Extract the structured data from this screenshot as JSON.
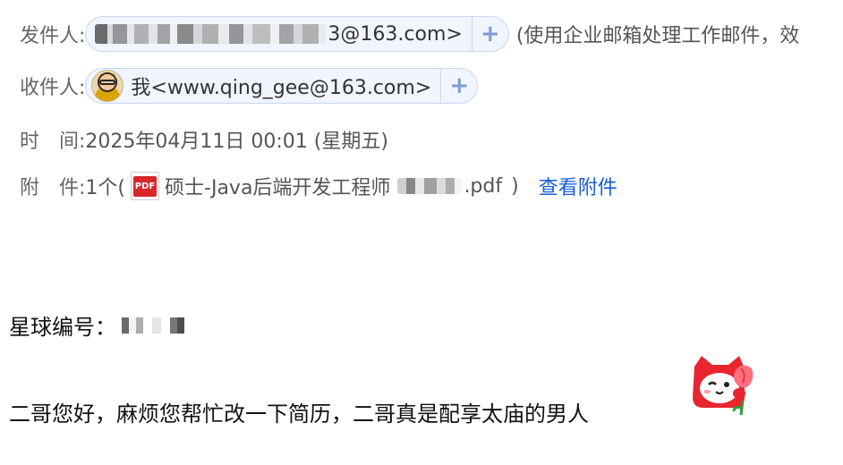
{
  "header": {
    "sender": {
      "label": "发件人:",
      "address_tail": "3@163.com>",
      "note": "(使用企业邮箱处理工作邮件，效"
    },
    "recipient": {
      "label": "收件人:",
      "name_address": "我<www.qing_gee@163.com>"
    },
    "time": {
      "label": "时　间:",
      "value": "2025年04月11日 00:01 (星期五)"
    },
    "attachment": {
      "label": "附　件:",
      "count_prefix": "1个(",
      "file_icon": "pdf-icon",
      "file_name": "硕士-Java后端开发工程师",
      "file_ext": ".pdf",
      "close_paren": ")",
      "view_link": "查看附件"
    }
  },
  "body": {
    "planet_label": "星球编号：",
    "message": "二哥您好，麻烦您帮忙改一下简历，二哥真是配享太庙的男人",
    "emoji": "cat-with-flower-sticker"
  },
  "icons": {
    "plus": "+",
    "pdf_text": "PDF"
  },
  "colors": {
    "chip_bg": "#f0f5ff",
    "chip_border": "#c7d7f3",
    "link": "#1a5fd6",
    "pdf_red": "#d9262b"
  }
}
